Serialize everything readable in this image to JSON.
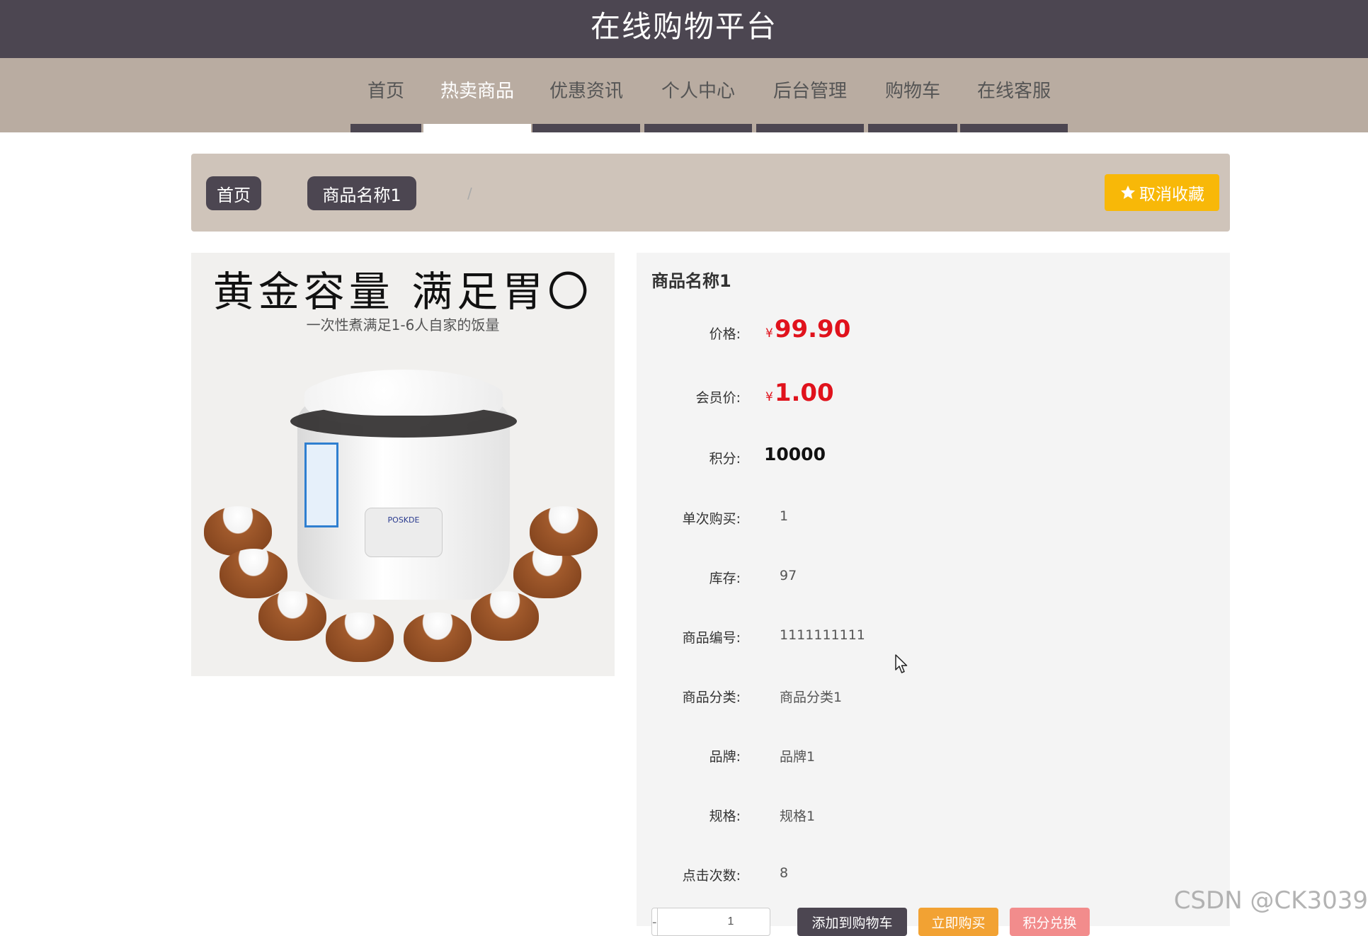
{
  "header": {
    "site_title": "在线购物平台"
  },
  "nav": {
    "items": [
      {
        "label": "首页"
      },
      {
        "label": "热卖商品"
      },
      {
        "label": "优惠资讯"
      },
      {
        "label": "个人中心"
      },
      {
        "label": "后台管理"
      },
      {
        "label": "购物车"
      },
      {
        "label": "在线客服"
      }
    ],
    "active": "热卖商品"
  },
  "breadcrumb": {
    "home": "首页",
    "separator": "/",
    "current": "商品名称1"
  },
  "favorite_button": {
    "label": "取消收藏",
    "icon": "star-icon",
    "color": "#f8b808"
  },
  "product_image": {
    "headline": "黄金容量 满足胃〇",
    "subline": "一次性煮满足1-6人自家的饭量",
    "brand_mark": "POSKDE"
  },
  "product": {
    "name": "商品名称1",
    "currency_symbol": "¥",
    "price_label": "价格:",
    "price": "99.90",
    "member_price_label": "会员价:",
    "member_price": "1.00",
    "points_label": "积分:",
    "points": "10000",
    "single_buy_label": "单次购买:",
    "single_buy": "1",
    "stock_label": "库存:",
    "stock": "97",
    "code_label": "商品编号:",
    "code": "1111111111",
    "category_label": "商品分类:",
    "category": "商品分类1",
    "brand_label": "品牌:",
    "brand": "品牌1",
    "spec_label": "规格:",
    "spec": "规格1",
    "clicks_label": "点击次数:",
    "clicks": "8"
  },
  "purchase": {
    "quantity": "1",
    "minus": "-",
    "plus": "+",
    "add_to_cart": "添加到购物车",
    "buy_now": "立即购买",
    "points_exchange": "积分兑换"
  },
  "colors": {
    "header_bg": "#4c4651",
    "nav_bg": "#b9aca1",
    "breadcrumb_bg": "#cfc4ba",
    "price_red": "#e0121c",
    "favorite_yellow": "#f8b808",
    "buy_orange": "#f2a233",
    "exchange_pink": "#f28c8c"
  },
  "watermark": "CSDN @CK3039"
}
